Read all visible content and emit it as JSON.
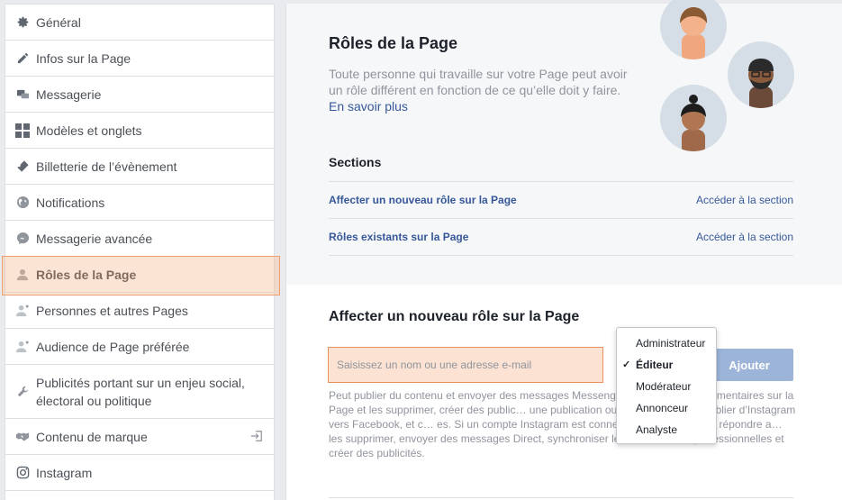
{
  "sidebar": {
    "items": [
      {
        "label": "Général",
        "icon": "gear-icon"
      },
      {
        "label": "Infos sur la Page",
        "icon": "pencil-icon"
      },
      {
        "label": "Messagerie",
        "icon": "chat-bubbles-icon"
      },
      {
        "label": "Modèles et onglets",
        "icon": "grid-icon"
      },
      {
        "label": "Billetterie de l’évènement",
        "icon": "ticket-icon"
      },
      {
        "label": "Notifications",
        "icon": "globe-icon"
      },
      {
        "label": "Messagerie avancée",
        "icon": "messenger-icon"
      },
      {
        "label": "Rôles de la Page",
        "icon": "person-icon"
      },
      {
        "label": "Personnes et autres Pages",
        "icon": "people-star-icon"
      },
      {
        "label": "Audience de Page préférée",
        "icon": "people-star-icon"
      },
      {
        "label": "Publicités portant sur un enjeu social, électoral ou politique",
        "icon": "wrench-icon"
      },
      {
        "label": "Contenu de marque",
        "icon": "handshake-icon"
      },
      {
        "label": "Instagram",
        "icon": "instagram-icon"
      }
    ]
  },
  "page_roles": {
    "title": "Rôles de la Page",
    "description": "Toute personne qui travaille sur votre Page peut avoir un rôle différent en fonction de ce qu’elle doit y faire.",
    "learn_more": "En savoir plus"
  },
  "sections": {
    "heading": "Sections",
    "rows": [
      {
        "label": "Affecter un nouveau rôle sur la Page",
        "link": "Accéder à la section"
      },
      {
        "label": "Rôles existants sur la Page",
        "link": "Accéder à la section"
      }
    ]
  },
  "assign": {
    "title": "Affecter un nouveau rôle sur la Page",
    "placeholder": "Saisissez un nom ou une adresse e-mail",
    "add_label": "Ajouter",
    "permissions_text": "Peut publier du contenu et envoyer des messages Messeng… répondre aux commentaires sur la Page et les supprimer, créer des public… une publication ou un commentaire, publier d’Instagram vers Facebook, et c… es. Si un compte Instagram est connecté à la Page, il peut répondre a… les supprimer, envoyer des messages Direct, synchroniser les coordonnées professionnelles et créer des publicités."
  },
  "role_dropdown": {
    "options": [
      "Administrateur",
      "Éditeur",
      "Modérateur",
      "Annonceur",
      "Analyste"
    ],
    "selected": "Éditeur",
    "check_glyph": "✓"
  },
  "colors": {
    "link": "#365899",
    "highlight": "#fbe2d2",
    "button": "#9cb4d8"
  }
}
